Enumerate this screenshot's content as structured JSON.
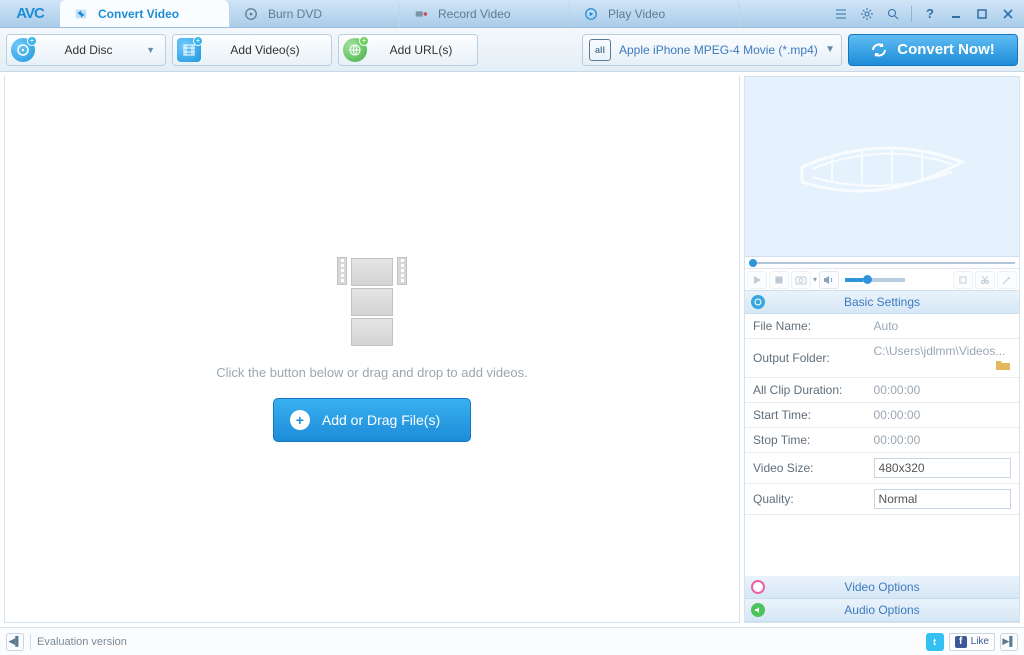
{
  "app": {
    "logo": "AVC"
  },
  "tabs": [
    {
      "label": "Convert Video",
      "active": true
    },
    {
      "label": "Burn DVD",
      "active": false
    },
    {
      "label": "Record Video",
      "active": false
    },
    {
      "label": "Play Video",
      "active": false
    }
  ],
  "toolbar": {
    "add_disc": "Add Disc",
    "add_videos": "Add Video(s)",
    "add_urls": "Add URL(s)",
    "profile": "Apple iPhone MPEG-4 Movie (*.mp4)",
    "all": "all",
    "convert": "Convert Now!"
  },
  "main": {
    "hint": "Click the button below or drag and drop to add videos.",
    "add_files": "Add or Drag File(s)"
  },
  "settings": {
    "header": "Basic Settings",
    "rows": {
      "file_name": {
        "k": "File Name:",
        "v": "Auto"
      },
      "output_folder": {
        "k": "Output Folder:",
        "v": "C:\\Users\\jdlmm\\Videos..."
      },
      "all_clip": {
        "k": "All Clip Duration:",
        "v": "00:00:00"
      },
      "start_time": {
        "k": "Start Time:",
        "v": "00:00:00"
      },
      "stop_time": {
        "k": "Stop Time:",
        "v": "00:00:00"
      },
      "video_size": {
        "k": "Video Size:",
        "v": "480x320"
      },
      "quality": {
        "k": "Quality:",
        "v": "Normal"
      }
    },
    "video_options": "Video Options",
    "audio_options": "Audio Options"
  },
  "status": {
    "version": "Evaluation version",
    "fb_like": "Like"
  }
}
